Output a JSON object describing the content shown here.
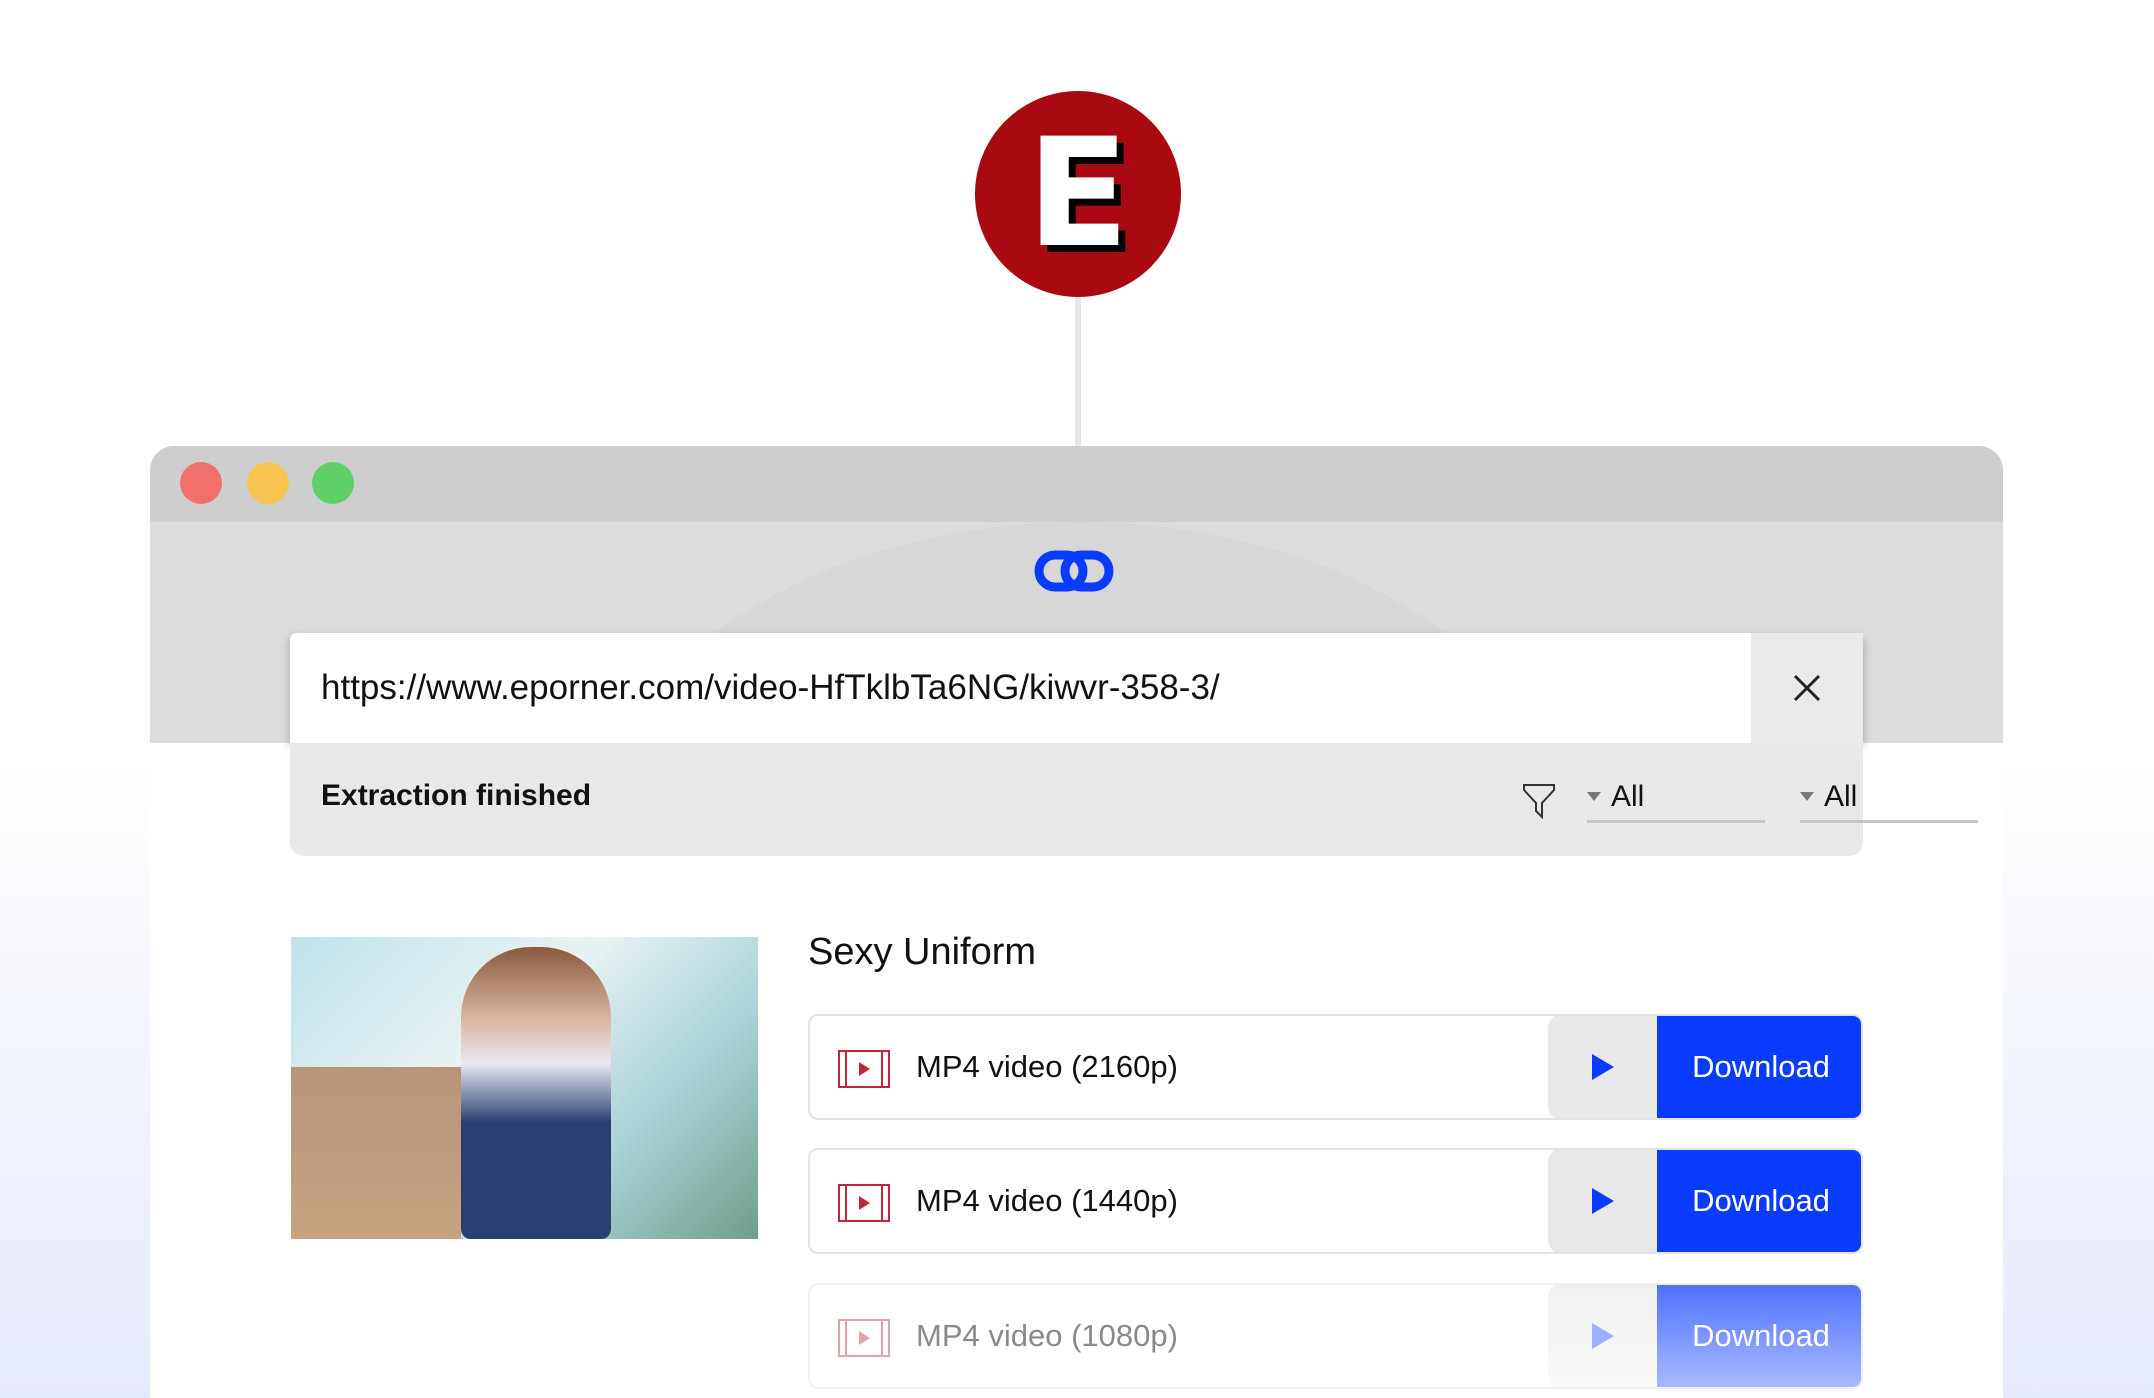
{
  "site_logo": {
    "letter": "E",
    "color": "#a90911"
  },
  "window": {
    "traffic_lights": [
      "#f2706b",
      "#f8c550",
      "#5fd068"
    ],
    "app_icon": "link-icon",
    "url_input": {
      "value": "https://www.eporner.com/video-HfTklbTa6NG/kiwvr-358-3/"
    },
    "status": {
      "text": "Extraction finished",
      "filter_icon": "filter-icon",
      "dropdowns": [
        {
          "selected": "All"
        },
        {
          "selected": "All"
        }
      ]
    },
    "result": {
      "title": "Sexy Uniform",
      "formats": [
        {
          "label": "MP4 video (2160p)",
          "button": "Download"
        },
        {
          "label": "MP4 video (1440p)",
          "button": "Download"
        },
        {
          "label": "MP4 video (1080p)",
          "button": "Download"
        }
      ]
    },
    "accent": "#0a3cff"
  }
}
